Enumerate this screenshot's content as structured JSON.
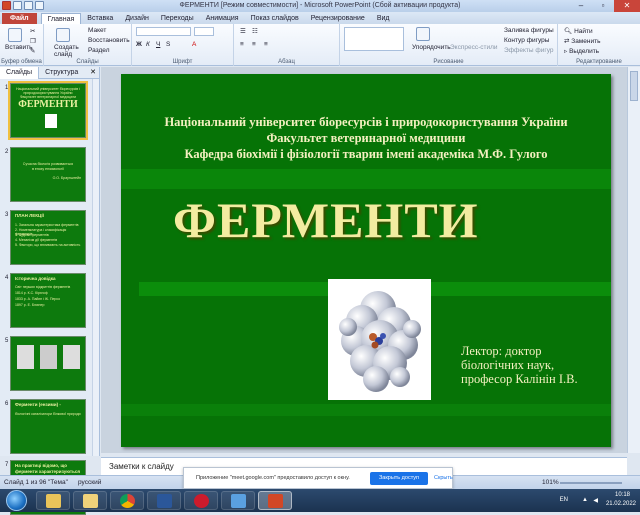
{
  "window": {
    "title": "ФЕРМЕНТИ [Режим совместимости] - Microsoft PowerPoint (Сбой активации продукта)"
  },
  "ribbon_tabs": [
    "Файл",
    "Главная",
    "Вставка",
    "Дизайн",
    "Переходы",
    "Анимация",
    "Показ слайдов",
    "Рецензирование",
    "Вид"
  ],
  "ribbon": {
    "paste": "Вставить",
    "clipboard": "Буфер обмена",
    "new_slide": "Создать слайд",
    "layout": "Макет",
    "reset": "Восстановить",
    "section": "Раздел",
    "slides_group": "Слайды",
    "font_group": "Шрифт",
    "paragraph_group": "Абзац",
    "arrange": "Упорядочить",
    "express_styles": "Экспресс-стили",
    "shape_fill": "Заливка фигуры",
    "shape_outline": "Контур фигуры",
    "shape_effects": "Эффекты фигур",
    "drawing_group": "Рисование",
    "find": "Найти",
    "replace": "Заменить",
    "select": "Выделить",
    "editing_group": "Редактирование"
  },
  "left_panel": {
    "tabs": [
      "Слайды",
      "Структура"
    ],
    "thumbnails": [
      {
        "num": "1",
        "lines": [
          "Національний університет біоресурсів і природокористування України",
          "Факультет ветеринарної медицини"
        ],
        "title": "ФЕРМЕНТИ"
      },
      {
        "num": "2",
        "lines": [
          "Сучасна біологія розвивається",
          "в епоху ензимології",
          "О.О. Браунштейн"
        ]
      },
      {
        "num": "3",
        "lines": [
          "ПЛАН ЛЕКЦІЇ",
          "1. Загальна характеристика ферментів",
          "2. Номенклатура і класифікація ферментів",
          "3. Будова ферментів",
          "4. Механізм дії ферментів",
          "5. Фактори, що впливають на активність"
        ]
      },
      {
        "num": "4",
        "lines": [
          "Історична довідка",
          "Світ перших відкриттів ферментів",
          "1814 р. К.С. Кірхгоф",
          "1833 р. А. Пайєн і Ж. Персо",
          "1897 р. Е. Бюхнер"
        ]
      },
      {
        "num": "5",
        "lines": []
      },
      {
        "num": "6",
        "lines": [
          "Ферменти (ензими) -",
          "біологічні каталізатори білкової природи"
        ]
      },
      {
        "num": "7",
        "lines": [
          "На практиці відомо, що",
          "ферменти характеризуються"
        ]
      }
    ]
  },
  "slide": {
    "university": "Національний університет біоресурсів і природокористування України",
    "faculty": "Факультет ветеринарної медицини",
    "department": "Кафедра біохімії і фізіології тварин імені академіка М.Ф. Гулого",
    "title": "ФЕРМЕНТИ",
    "lector_1": "Лектор: доктор",
    "lector_2": "біологічних наук,",
    "lector_3": "професор Калінін І.В."
  },
  "notes": {
    "placeholder": "Заметки к слайду"
  },
  "statusbar": {
    "slide": "Слайд 1 из 96",
    "theme": "\"Тема\"",
    "lang": "русский",
    "zoom": "101%"
  },
  "notification": {
    "text": "Приложение \"meet.google.com\" предоставило доступ к окну.",
    "share": "Закрыть доступ",
    "hide": "Скрыть"
  },
  "tray": {
    "lang": "EN",
    "time": "10:18",
    "date": "21.02.2022"
  },
  "colors": {
    "slide_bg": "#067306",
    "slide_text": "#f4f0c0",
    "title_text": "#f3eca0",
    "file_tab": "#c0453a"
  }
}
